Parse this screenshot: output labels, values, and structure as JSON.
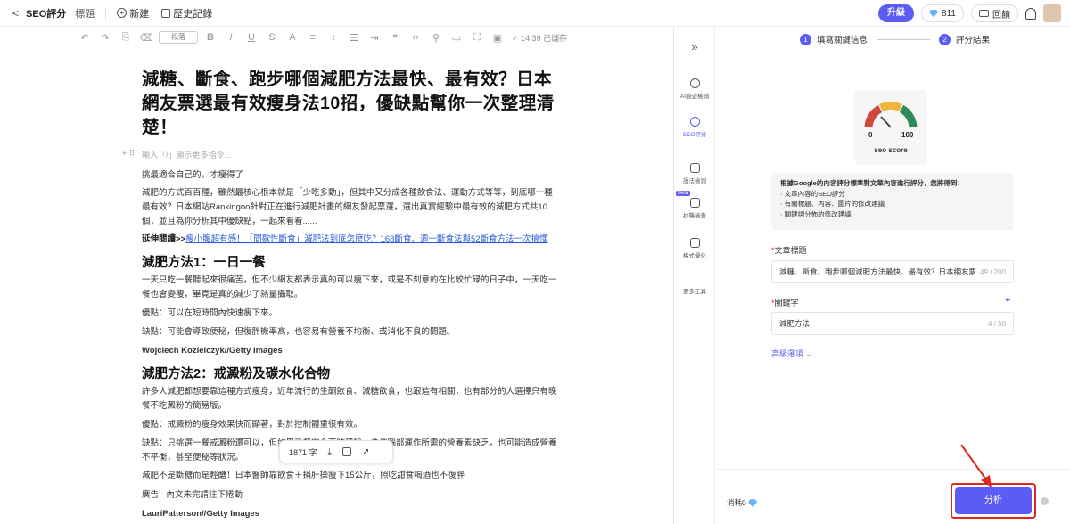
{
  "topbar": {
    "back_label": "<",
    "app_title": "SEO評分",
    "title_label": "標題",
    "new_label": "新建",
    "history_label": "歷史記錄",
    "upgrade_label": "升級",
    "credits": "811",
    "feedback_label": "回饋"
  },
  "toolbar": {
    "paragraph_select": "段落",
    "saved_status": "14:39 已儲存"
  },
  "article": {
    "title": "減糖、斷食、跑步哪個減肥方法最快、最有效？日本網友票選最有效瘦身法10招，優缺點幫你一次整理清楚！",
    "placeholder": "輸入「/」顯示更多指令...",
    "p1": "挑最適合自己的，才瘦得了",
    "p2": "減肥的方式百百種，雖然最核心根本就是「少吃多動」，但其中又分成各種飲食法、運動方式等等，到底哪一種最有效？日本網站Rankingoo針對正在進行減肥計畫的網友發起票選，選出真實經驗中最有效的減肥方式共10個，並且為你分析其中優缺點，一起來看看......",
    "ext_label": "延伸閱讀>>",
    "ext_link": "瘦小腹超有感！「間歇性斷食」減肥法到底怎麼吃？168斷食、週一斷食法與52斷食方法一次搞懂",
    "h2a": "減肥方法1：一日一餐",
    "p3": "一天只吃一餐聽起來很痛苦，但不少網友都表示真的可以瘦下來，或是不刻意的在比較忙碌的日子中，一天吃一餐也會變瘦，畢竟是真的減少了熱量攝取。",
    "p4": "優點：可以在短時間內快速瘦下來。",
    "p5": "缺點：可能會導致便秘，但復胖機率高，也容易有營養不均衡、或消化不良的問題。",
    "credit1": "Wojciech Kozielczyk//Getty Images",
    "h2b": "減肥方法2：戒澱粉及碳水化合物",
    "p6": "許多人減肥都想要靠這種方式瘦身，近年流行的生酮飲食、減糖飲食，也跟這有相關，也有部分的人選擇只有晚餐不吃澱粉的簡易版。",
    "p7": "優點：戒澱粉的瘦身效果快而顯著，對於控制體重很有效。",
    "p8": "缺點：只挑選一餐戒澱粉還可以，但如果三餐完全不吃澱粉，會使腦部運作所需的營養素缺乏，也可能造成營養不平衡，甚至便秘等狀況。",
    "link2": "減肥不是斷糖而是輕醣！日本醫師靠飲食＋捐肝操瘦下15公斤，照吃甜食喝酒也不復胖",
    "ad": "廣告 - 內文未完請往下捲動",
    "credit2": "LauriPatterson//Getty Images"
  },
  "floatbar": {
    "word_count": "1871 字"
  },
  "sidebar": {
    "items": [
      "AI痕迹檢測",
      "SEO評分",
      "語法檢測",
      "抄襲檢查",
      "格式優化",
      "更多工具"
    ],
    "beta_label": "Beta"
  },
  "panel": {
    "step1_num": "1",
    "step1_label": "填寫關鍵信息",
    "step2_num": "2",
    "step2_label": "評分結果",
    "gauge_min": "0",
    "gauge_max": "100",
    "gauge_label": "seo score",
    "info_heading": "根據Google的內容評分標準對文章內容進行評分，您將得到：",
    "info_items": [
      "· 文章內容的SEO評分",
      "· 有關標題、內容、圖片的修改建議",
      "· 關鍵詞分佈的修改建議"
    ],
    "title_field_label": "文章標題",
    "title_field_value": "減糖、斷食、跑步哪個減肥方法最快、最有效？日本網友票選",
    "title_field_count": "49 / 200",
    "keyword_field_label": "關鍵字",
    "keyword_field_value": "減肥方法",
    "keyword_field_count": "4 / 50",
    "advanced_label": "高級選項",
    "cost_label": "消耗0",
    "analyze_label": "分析"
  },
  "colors": {
    "accent": "#5b5bf6",
    "highlight": "#e0271f",
    "link": "#2b5cd6"
  }
}
